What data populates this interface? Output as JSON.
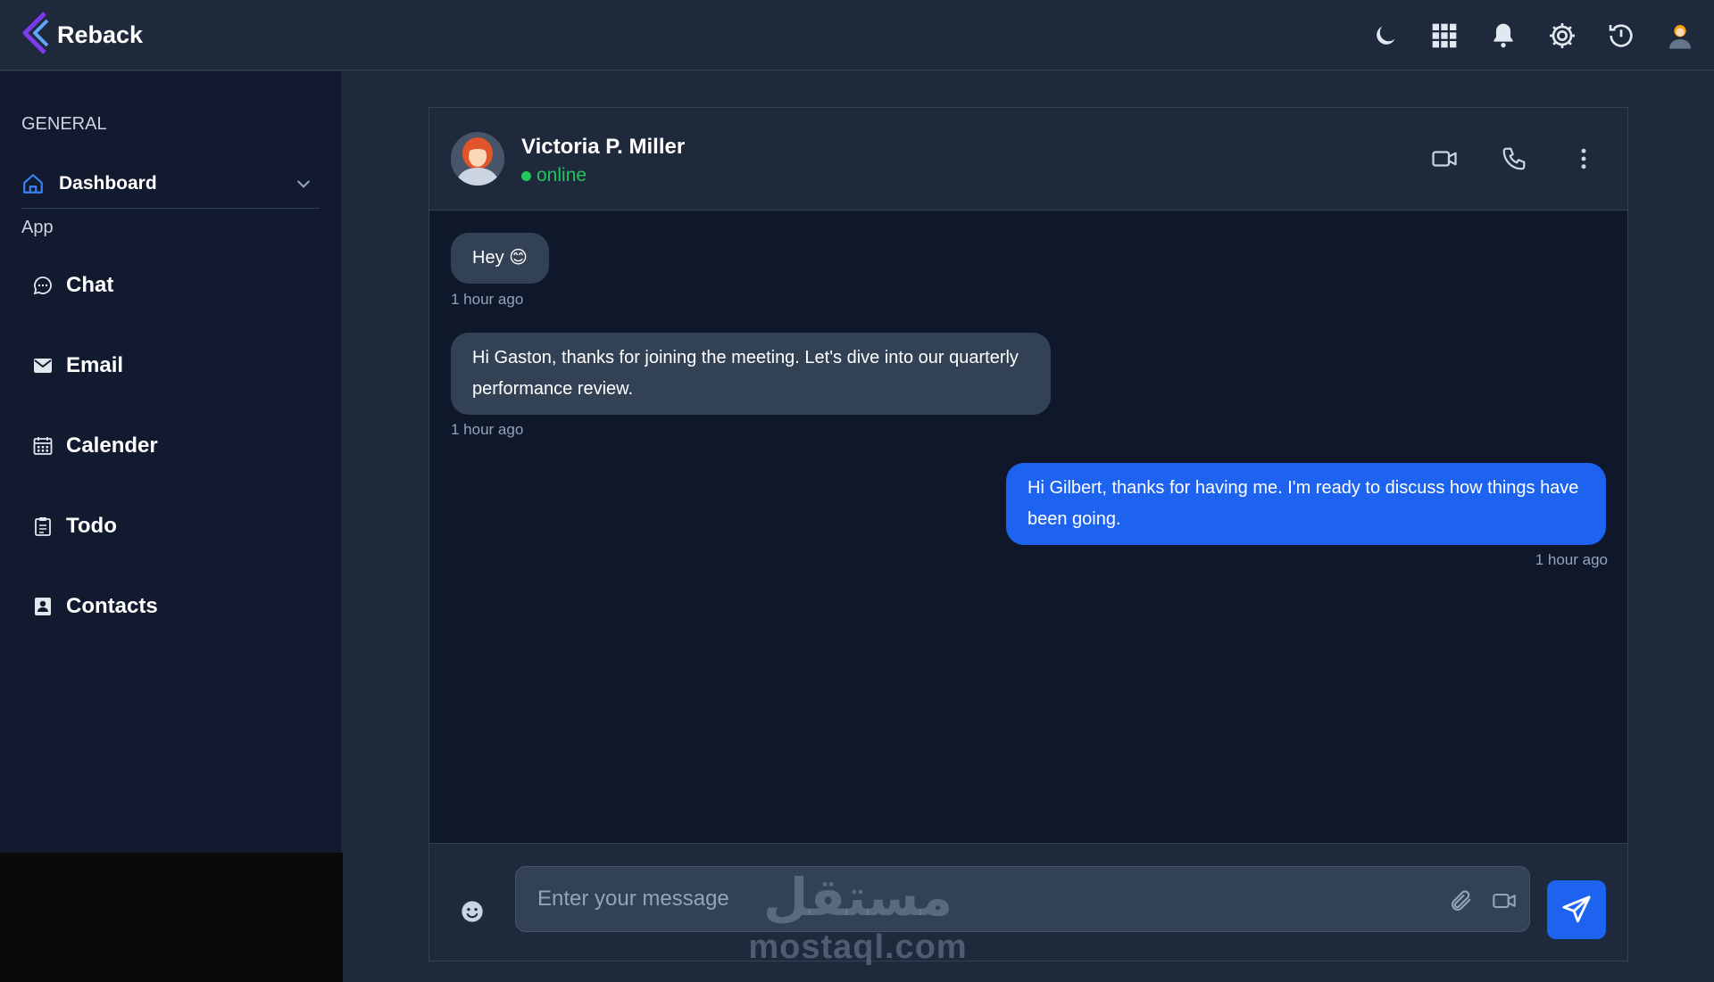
{
  "app": {
    "name": "Reback"
  },
  "topbar": {
    "icons": [
      "moon-icon",
      "apps-grid-icon",
      "bell-icon",
      "gear-icon",
      "history-icon",
      "user-avatar-icon"
    ]
  },
  "sidebar": {
    "general_label": "GENERAL",
    "dashboard_label": "Dashboard",
    "app_label": "App",
    "items": [
      {
        "label": "Chat",
        "icon": "chat-bubble-icon"
      },
      {
        "label": "Email",
        "icon": "envelope-icon"
      },
      {
        "label": "Calender",
        "icon": "calendar-icon"
      },
      {
        "label": "Todo",
        "icon": "clipboard-icon"
      },
      {
        "label": "Contacts",
        "icon": "contacts-icon"
      }
    ]
  },
  "chat": {
    "contact_name": "Victoria P. Miller",
    "status": "online",
    "messages": [
      {
        "direction": "in",
        "text": "Hey 😊",
        "time": "1 hour ago"
      },
      {
        "direction": "in",
        "text": "Hi Gaston, thanks for joining the meeting. Let's dive into our quarterly performance review.",
        "time": "1 hour ago"
      },
      {
        "direction": "out",
        "text": "Hi Gilbert, thanks for having me. I'm ready to discuss how things have been going.",
        "time": "1 hour ago"
      }
    ],
    "composer_placeholder": "Enter your message"
  },
  "watermark": {
    "logo": "مستقل",
    "text": "mostaql.com"
  },
  "colors": {
    "accent": "#1d63f0",
    "online": "#22c55e",
    "background": "#0f172a",
    "panel": "#1e293b"
  }
}
